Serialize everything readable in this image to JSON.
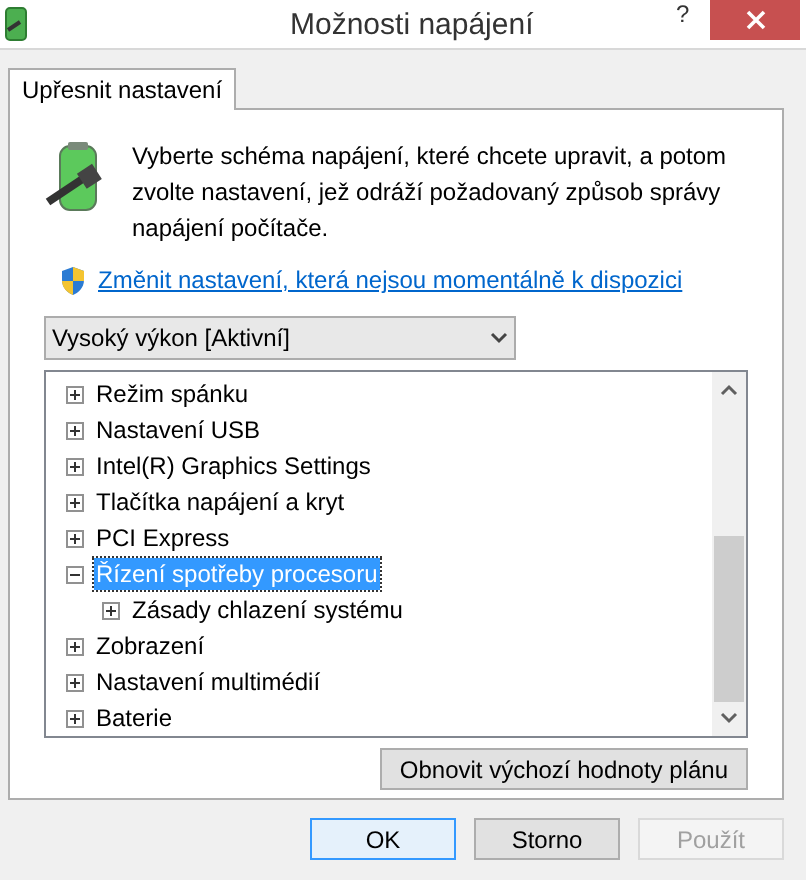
{
  "window": {
    "title": "Možnosti napájení",
    "help": "?"
  },
  "tabs": [
    {
      "label": "Upřesnit nastavení",
      "selected": true
    }
  ],
  "description": "Vyberte schéma napájení, které chcete upravit, a potom zvolte nastavení, jež odráží požadovaný způsob správy napájení počítače.",
  "link": "Změnit nastavení, která nejsou momentálně k dispozici",
  "plan_select": {
    "value": "Vysoký výkon [Aktivní]"
  },
  "tree": [
    {
      "label": "Režim spánku",
      "expanded": false,
      "selected": false
    },
    {
      "label": "Nastavení USB",
      "expanded": false,
      "selected": false
    },
    {
      "label": "Intel(R) Graphics Settings",
      "expanded": false,
      "selected": false
    },
    {
      "label": "Tlačítka napájení a kryt",
      "expanded": false,
      "selected": false
    },
    {
      "label": "PCI Express",
      "expanded": false,
      "selected": false
    },
    {
      "label": "Řízení spotřeby procesoru",
      "expanded": true,
      "selected": true,
      "children": [
        {
          "label": "Zásady chlazení systému",
          "expanded": false,
          "selected": false
        }
      ]
    },
    {
      "label": "Zobrazení",
      "expanded": false,
      "selected": false
    },
    {
      "label": "Nastavení multimédií",
      "expanded": false,
      "selected": false
    },
    {
      "label": "Baterie",
      "expanded": false,
      "selected": false
    }
  ],
  "restore_button": "Obnovit výchozí hodnoty plánu",
  "buttons": [
    {
      "label": "OK",
      "kind": "default",
      "disabled": false
    },
    {
      "label": "Storno",
      "kind": "normal",
      "disabled": false
    },
    {
      "label": "Použít",
      "kind": "normal",
      "disabled": true
    }
  ]
}
